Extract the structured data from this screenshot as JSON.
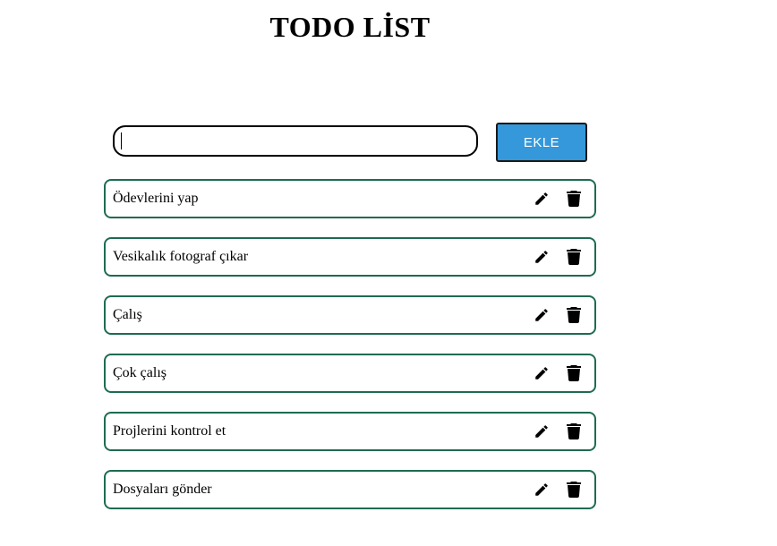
{
  "header": {
    "title": "TODO LİST"
  },
  "form": {
    "input_value": "",
    "input_placeholder": "",
    "add_label": "EKLE",
    "add_color": "#3498db"
  },
  "todos": [
    {
      "text": "Ödevlerini yap",
      "edit_icon": "pencil-icon",
      "delete_icon": "trash-icon"
    },
    {
      "text": "Vesikalık fotograf çıkar",
      "edit_icon": "pencil-icon",
      "delete_icon": "trash-icon"
    },
    {
      "text": "Çalış",
      "edit_icon": "pencil-icon",
      "delete_icon": "trash-icon"
    },
    {
      "text": "Çok çalış",
      "edit_icon": "pencil-icon",
      "delete_icon": "trash-icon"
    },
    {
      "text": "Projlerini kontrol et",
      "edit_icon": "pencil-icon",
      "delete_icon": "trash-icon"
    },
    {
      "text": "Dosyaları gönder",
      "edit_icon": "pencil-icon",
      "delete_icon": "trash-icon"
    }
  ],
  "colors": {
    "item_border": "#1e6b52"
  }
}
